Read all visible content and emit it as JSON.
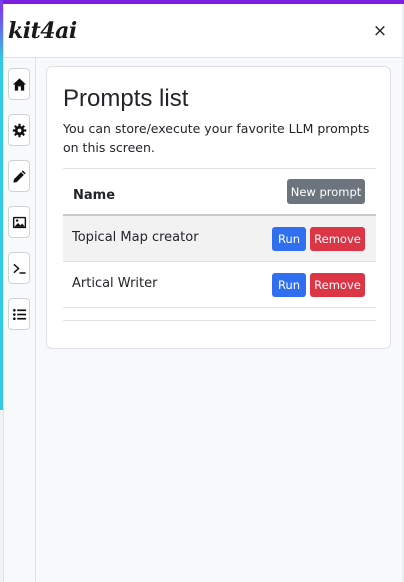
{
  "app": {
    "logo_text": "kit4ai",
    "close_label": "×"
  },
  "sidebar": {
    "items": [
      {
        "icon": "home-icon"
      },
      {
        "icon": "gear-icon"
      },
      {
        "icon": "pencil-icon"
      },
      {
        "icon": "image-icon"
      },
      {
        "icon": "terminal-icon"
      },
      {
        "icon": "list-icon"
      }
    ]
  },
  "main": {
    "title": "Prompts list",
    "description": "You can store/execute your favorite LLM prompts on this screen.",
    "table": {
      "header_name": "Name",
      "new_button": "New prompt",
      "rows": [
        {
          "name": "Topical Map creator",
          "run_label": "Run",
          "remove_label": "Remove"
        },
        {
          "name": "Artical Writer",
          "run_label": "Run",
          "remove_label": "Remove"
        }
      ]
    }
  },
  "colors": {
    "accent_purple": "#7b1fe0",
    "primary": "#2f6ff0",
    "danger": "#dc3545",
    "secondary": "#6c757d"
  }
}
